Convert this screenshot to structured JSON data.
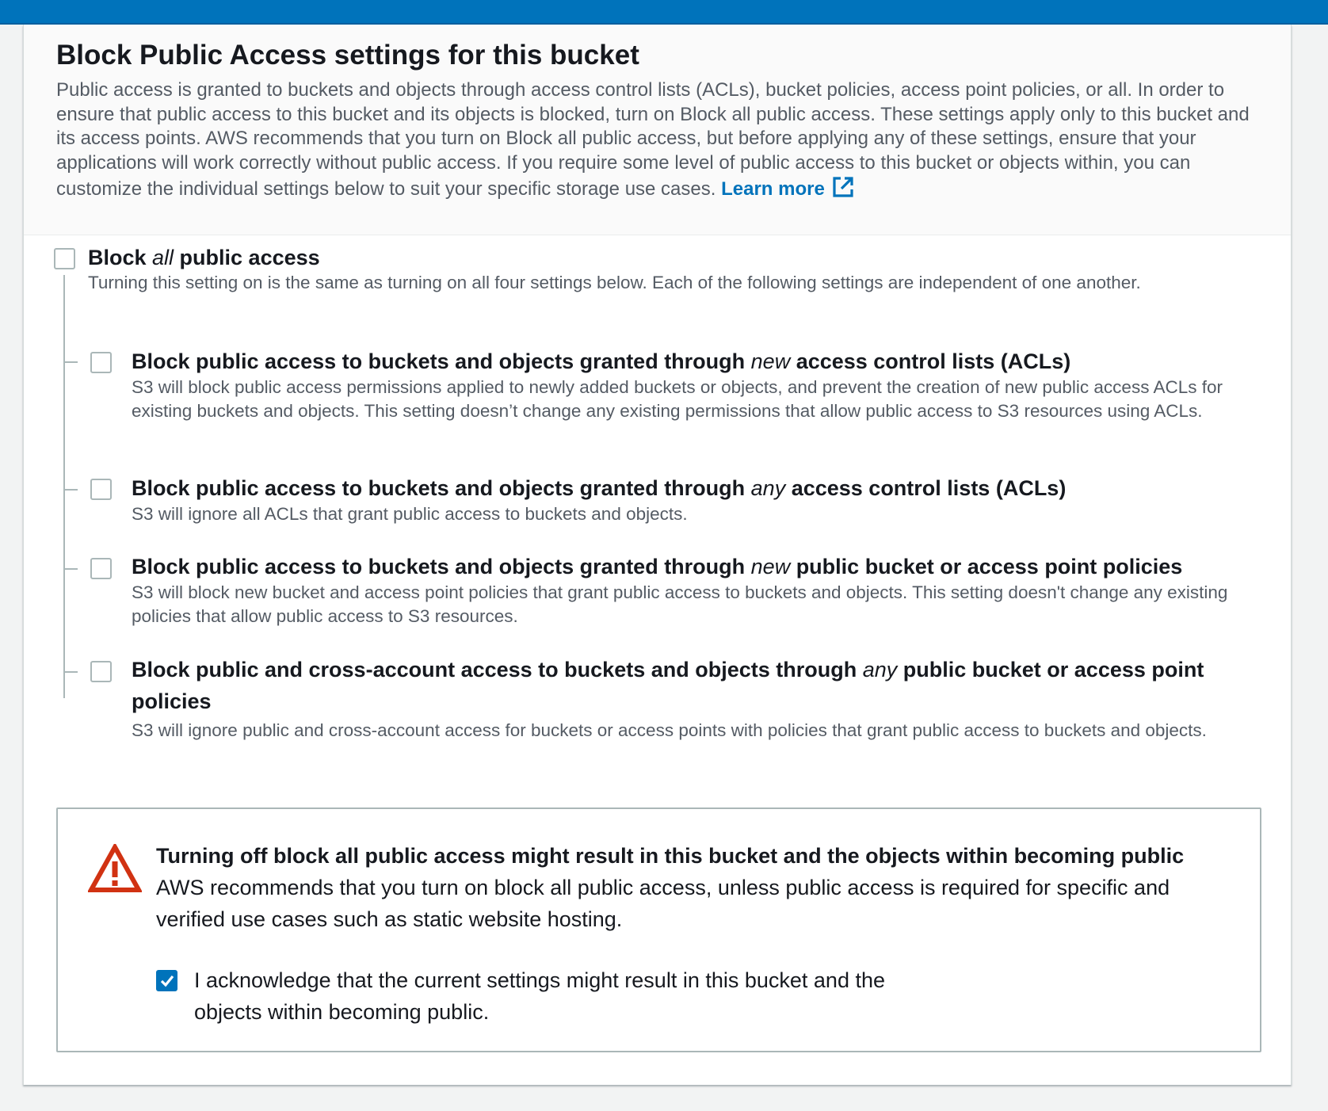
{
  "header": {
    "title": "Block Public Access settings for this bucket",
    "description": "Public access is granted to buckets and objects through access control lists (ACLs), bucket policies, access point policies, or all. In order to ensure that public access to this bucket and its objects is blocked, turn on Block all public access. These settings apply only to this bucket and its access points. AWS recommends that you turn on Block all public access, but before applying any of these settings, ensure that your applications will work correctly without public access. If you require some level of public access to this bucket or objects within, you can customize the individual settings below to suit your specific storage use cases.",
    "learn_more": "Learn more"
  },
  "block_all": {
    "title_pre": "Block ",
    "title_em": "all",
    "title_post": " public access",
    "desc": "Turning this setting on is the same as turning on all four settings below. Each of the following settings are independent of one another.",
    "checked": false
  },
  "options": [
    {
      "title_pre": "Block public access to buckets and objects granted through ",
      "title_em": "new",
      "title_post": " access control lists (ACLs)",
      "desc": "S3 will block public access permissions applied to newly added buckets or objects, and prevent the creation of new public access ACLs for existing buckets and objects. This setting doesn’t change any existing permissions that allow public access to S3 resources using ACLs.",
      "checked": false
    },
    {
      "title_pre": "Block public access to buckets and objects granted through ",
      "title_em": "any",
      "title_post": " access control lists (ACLs)",
      "desc": "S3 will ignore all ACLs that grant public access to buckets and objects.",
      "checked": false
    },
    {
      "title_pre": "Block public access to buckets and objects granted through ",
      "title_em": "new",
      "title_post": " public bucket or access point policies",
      "desc": "S3 will block new bucket and access point policies that grant public access to buckets and objects. This setting doesn't change any existing policies that allow public access to S3 resources.",
      "checked": false
    },
    {
      "title_pre": "Block public and cross-account access to buckets and objects through ",
      "title_em": "any",
      "title_post": " public bucket or access point policies",
      "desc": "S3 will ignore public and cross-account access for buckets or access points with policies that grant public access to buckets and objects.",
      "checked": false
    }
  ],
  "alert": {
    "icon": "warning-triangle-icon",
    "title": "Turning off block all public access might result in this bucket and the objects within becoming public",
    "body": "AWS recommends that you turn on block all public access, unless public access is required for specific and verified use cases such as static website hosting.",
    "ack_label": "I acknowledge that the current settings might result in this bucket and the objects within becoming public.",
    "ack_checked": true
  },
  "colors": {
    "accent": "#0073bb",
    "warning": "#d13212",
    "text": "#16191f",
    "secondary_text": "#545b64"
  }
}
